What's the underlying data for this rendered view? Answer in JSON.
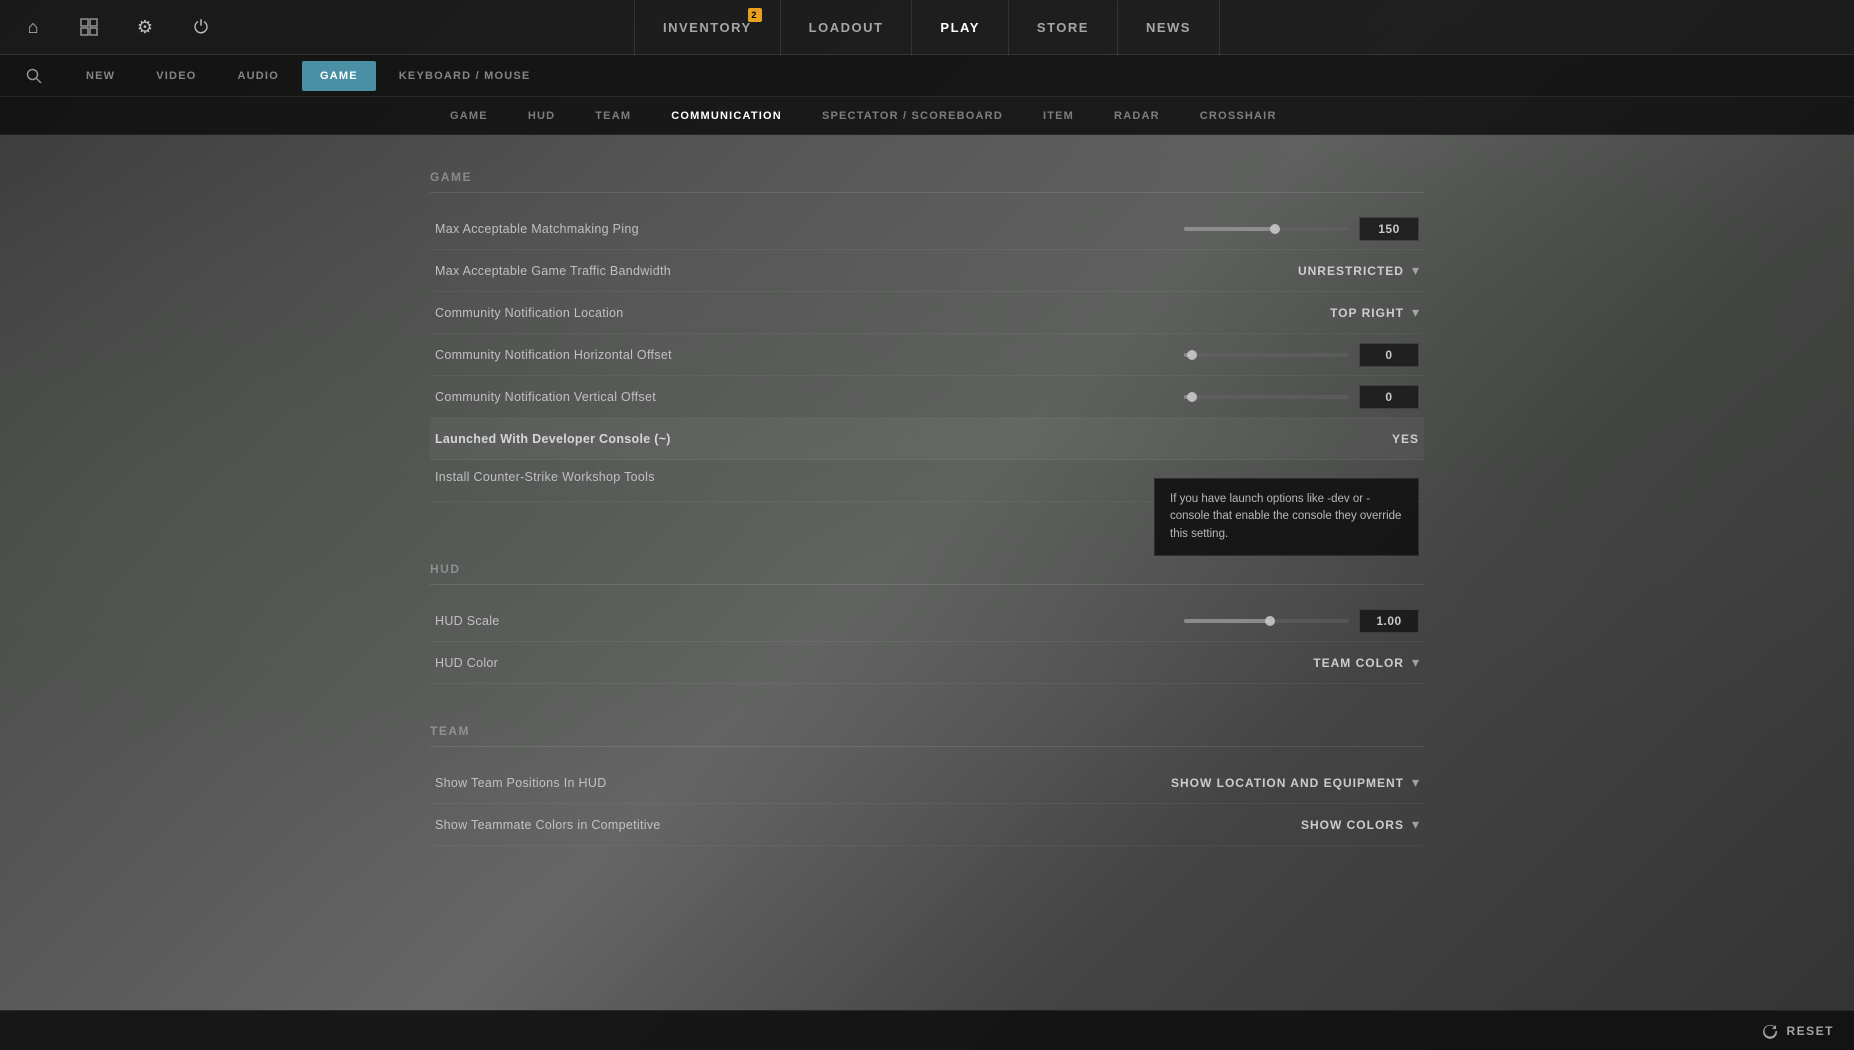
{
  "nav": {
    "items": [
      {
        "id": "inventory",
        "label": "INVENTORY",
        "badge": "2",
        "active": false
      },
      {
        "id": "loadout",
        "label": "LOADOUT",
        "badge": null,
        "active": false
      },
      {
        "id": "play",
        "label": "PLAY",
        "badge": null,
        "active": true
      },
      {
        "id": "store",
        "label": "STORE",
        "badge": null,
        "active": false
      },
      {
        "id": "news",
        "label": "NEWS",
        "badge": null,
        "active": false
      }
    ],
    "left_icons": [
      {
        "id": "home",
        "symbol": "⌂"
      },
      {
        "id": "missions",
        "symbol": "▦"
      },
      {
        "id": "settings",
        "symbol": "⚙"
      },
      {
        "id": "power",
        "symbol": "⏻"
      }
    ]
  },
  "settings_tabs": {
    "items": [
      {
        "id": "new",
        "label": "NEW",
        "active": false
      },
      {
        "id": "video",
        "label": "VIDEO",
        "active": false
      },
      {
        "id": "audio",
        "label": "AUDIO",
        "active": false
      },
      {
        "id": "game",
        "label": "GAME",
        "active": true
      },
      {
        "id": "keyboard_mouse",
        "label": "KEYBOARD / MOUSE",
        "active": false
      }
    ]
  },
  "sub_tabs": {
    "items": [
      {
        "id": "game",
        "label": "GAME",
        "active": false
      },
      {
        "id": "hud",
        "label": "HUD",
        "active": false
      },
      {
        "id": "team",
        "label": "TEAM",
        "active": false
      },
      {
        "id": "communication",
        "label": "COMMUNICATION",
        "active": true
      },
      {
        "id": "spectator_scoreboard",
        "label": "SPECTATOR / SCOREBOARD",
        "active": false
      },
      {
        "id": "item",
        "label": "ITEM",
        "active": false
      },
      {
        "id": "radar",
        "label": "RADAR",
        "active": false
      },
      {
        "id": "crosshair",
        "label": "CROSSHAIR",
        "active": false
      }
    ]
  },
  "sections": {
    "game": {
      "title": "Game",
      "settings": [
        {
          "id": "matchmaking_ping",
          "label": "Max Acceptable Matchmaking Ping",
          "type": "slider",
          "value": "150",
          "fill_percent": 55
        },
        {
          "id": "game_traffic_bandwidth",
          "label": "Max Acceptable Game Traffic Bandwidth",
          "type": "dropdown",
          "value": "UNRESTRICTED"
        },
        {
          "id": "community_notification_location",
          "label": "Community Notification Location",
          "type": "dropdown",
          "value": "TOP RIGHT"
        },
        {
          "id": "community_notification_horizontal",
          "label": "Community Notification Horizontal Offset",
          "type": "slider",
          "value": "0",
          "fill_percent": 5
        },
        {
          "id": "community_notification_vertical",
          "label": "Community Notification Vertical Offset",
          "type": "slider",
          "value": "0",
          "fill_percent": 5
        },
        {
          "id": "developer_console",
          "label": "Launched With Developer Console (~)",
          "type": "text",
          "value": "YES",
          "bold": true
        },
        {
          "id": "workshop_tools",
          "label": "Install Counter-Strike Workshop Tools",
          "type": "tooltip",
          "tooltip": "If you have launch options like -dev or -console that enable the console they override this setting."
        }
      ]
    },
    "hud": {
      "title": "Hud",
      "settings": [
        {
          "id": "hud_scale",
          "label": "HUD Scale",
          "type": "slider",
          "value": "1.00",
          "fill_percent": 52
        },
        {
          "id": "hud_color",
          "label": "HUD Color",
          "type": "dropdown",
          "value": "TEAM COLOR"
        }
      ]
    },
    "team": {
      "title": "Team",
      "settings": [
        {
          "id": "show_team_positions",
          "label": "Show Team Positions In HUD",
          "type": "dropdown",
          "value": "SHOW LOCATION AND EQUIPMENT"
        },
        {
          "id": "teammate_colors_competitive",
          "label": "Show Teammate Colors in Competitive",
          "type": "dropdown",
          "value": "SHOW COLORS"
        }
      ]
    }
  },
  "bottom": {
    "reset_label": "RESET"
  }
}
